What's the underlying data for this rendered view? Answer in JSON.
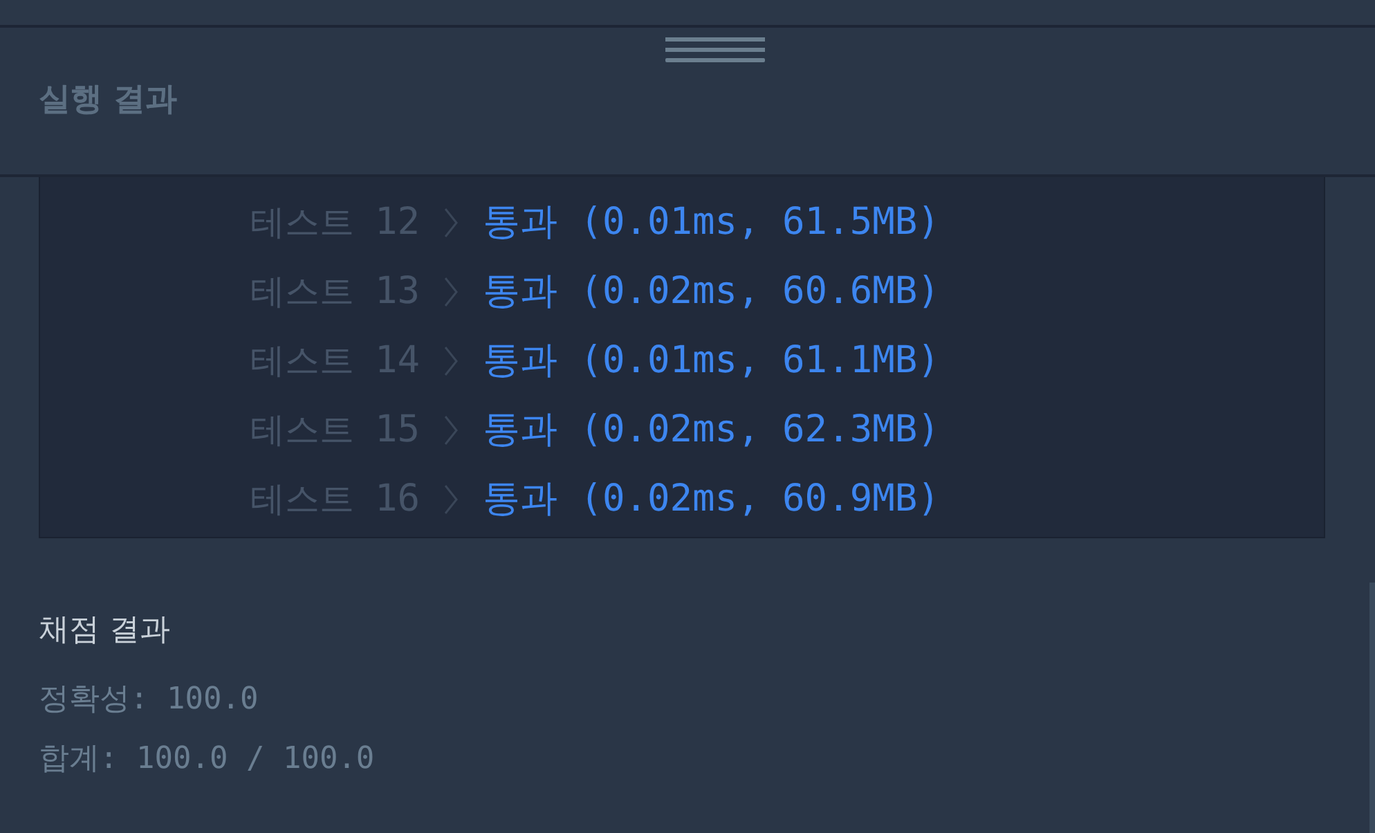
{
  "header": {
    "title": "실행 결과"
  },
  "console": {
    "rows": [
      {
        "label": "테스트",
        "number": "12",
        "result": "통과 (0.01ms, 61.5MB)"
      },
      {
        "label": "테스트",
        "number": "13",
        "result": "통과 (0.02ms, 60.6MB)"
      },
      {
        "label": "테스트",
        "number": "14",
        "result": "통과 (0.01ms, 61.1MB)"
      },
      {
        "label": "테스트",
        "number": "15",
        "result": "통과 (0.02ms, 62.3MB)"
      },
      {
        "label": "테스트",
        "number": "16",
        "result": "통과 (0.02ms, 60.9MB)"
      }
    ]
  },
  "grading": {
    "title": "채점 결과",
    "lines": [
      "정확성: 100.0",
      "합계: 100.0 / 100.0"
    ]
  }
}
